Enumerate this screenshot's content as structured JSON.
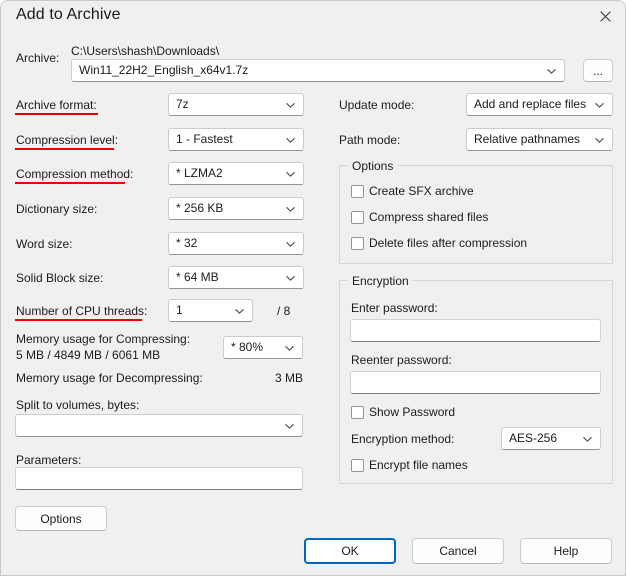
{
  "window": {
    "title": "Add to Archive",
    "close_icon": "close-icon"
  },
  "archive": {
    "label": "Archive:",
    "path": "C:\\Users\\shash\\Downloads\\",
    "filename": "Win11_22H2_English_x64v1.7z",
    "browse_label": "..."
  },
  "left_column": {
    "rows": [
      {
        "label": "Archive format:",
        "value": "7z",
        "underlined": true
      },
      {
        "label": "Compression level:",
        "value": "1 - Fastest",
        "underlined": true
      },
      {
        "label": "Compression method:",
        "value": "* LZMA2",
        "underlined": true
      },
      {
        "label": "Dictionary size:",
        "value": "* 256 KB",
        "underlined": false
      },
      {
        "label": "Word size:",
        "value": "* 32",
        "underlined": false
      },
      {
        "label": "Solid Block size:",
        "value": "* 64 MB",
        "underlined": false
      }
    ],
    "cpu_threads": {
      "label": "Number of CPU threads:",
      "value": "1",
      "total": "/ 8",
      "underlined": true
    },
    "memory_compress": {
      "label": "Memory usage for Compressing:",
      "value": "5 MB / 4849 MB / 6061 MB",
      "percent": "* 80%"
    },
    "memory_decompress": {
      "label": "Memory usage for Decompressing:",
      "value": "3 MB"
    },
    "split_volumes": {
      "label": "Split to volumes, bytes:",
      "value": ""
    },
    "parameters": {
      "label": "Parameters:",
      "value": ""
    },
    "options_button": "Options"
  },
  "right_column": {
    "update_mode": {
      "label": "Update mode:",
      "value": "Add and replace files"
    },
    "path_mode": {
      "label": "Path mode:",
      "value": "Relative pathnames"
    },
    "options_group": {
      "title": "Options",
      "checkboxes": [
        {
          "label": "Create SFX archive",
          "checked": false
        },
        {
          "label": "Compress shared files",
          "checked": false
        },
        {
          "label": "Delete files after compression",
          "checked": false
        }
      ]
    },
    "encryption_group": {
      "title": "Encryption",
      "enter_password_label": "Enter password:",
      "enter_password_value": "",
      "reenter_password_label": "Reenter password:",
      "reenter_password_value": "",
      "show_password": {
        "label": "Show Password",
        "checked": false
      },
      "encryption_method_label": "Encryption method:",
      "encryption_method_value": "AES-256",
      "encrypt_file_names": {
        "label": "Encrypt file names",
        "checked": false
      }
    }
  },
  "footer": {
    "ok": "OK",
    "cancel": "Cancel",
    "help": "Help"
  },
  "colors": {
    "annotation_red": "#ef0000",
    "accent_blue": "#0067c0",
    "dialog_bg": "#f0f0f0"
  }
}
